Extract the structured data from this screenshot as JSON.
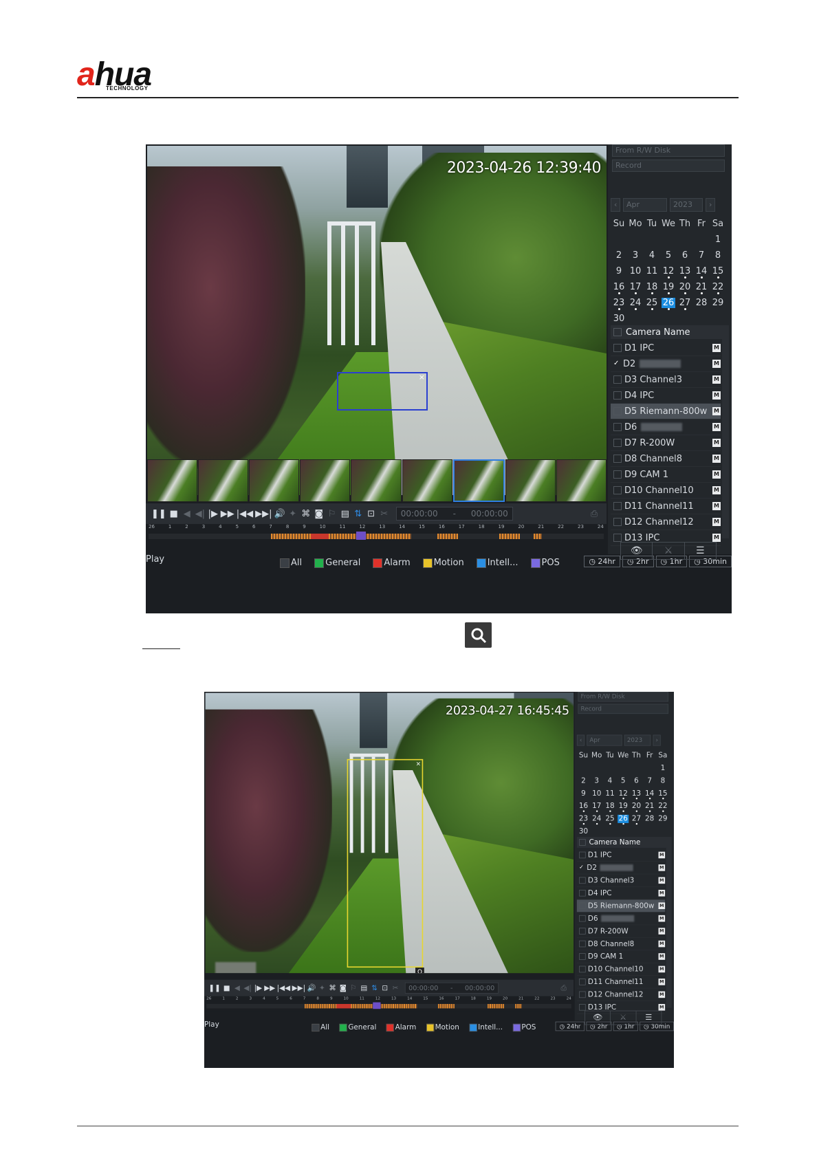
{
  "logo": {
    "brand_a": "a",
    "brand_rest": "hua",
    "subtitle": "TECHNOLOGY"
  },
  "player": {
    "timestamp_1": "2023-04-26 12:39:40",
    "timestamp_2": "2023-04-27 16:45:45",
    "toolbar_time_start": "00:00:00",
    "toolbar_time_end": "00:00:00",
    "timeline_hours": [
      "26",
      "1",
      "2",
      "3",
      "4",
      "5",
      "6",
      "7",
      "8",
      "9",
      "10",
      "11",
      "12",
      "13",
      "14",
      "15",
      "16",
      "17",
      "18",
      "19",
      "20",
      "21",
      "22",
      "23",
      "24"
    ],
    "play_label": "Play",
    "legend": [
      {
        "label": "All",
        "color": "#3a3f45"
      },
      {
        "label": "General",
        "color": "#22b14c"
      },
      {
        "label": "Alarm",
        "color": "#e0322b"
      },
      {
        "label": "Motion",
        "color": "#e8c32a"
      },
      {
        "label": "Intell...",
        "color": "#2b8fe3"
      },
      {
        "label": "POS",
        "color": "#7a6ae0"
      }
    ],
    "periods": [
      "24hr",
      "2hr",
      "1hr",
      "30min"
    ]
  },
  "panel": {
    "source_select": "From R/W Disk",
    "type_select": "Record",
    "month_select": "Apr",
    "year_select": "2023",
    "weekdays": [
      "Su",
      "Mo",
      "Tu",
      "We",
      "Th",
      "Fr",
      "Sa"
    ],
    "weeks": [
      [
        "",
        "",
        "",
        "",
        "",
        "",
        "1"
      ],
      [
        "2",
        "3",
        "4",
        "5",
        "6",
        "7",
        "8"
      ],
      [
        "9",
        "10",
        "11",
        "12",
        "13",
        "14",
        "15"
      ],
      [
        "16",
        "17",
        "18",
        "19",
        "20",
        "21",
        "22"
      ],
      [
        "23",
        "24",
        "25",
        "26",
        "27",
        "28",
        "29"
      ],
      [
        "30",
        "",
        "",
        "",
        "",
        "",
        ""
      ]
    ],
    "selected_day": "26",
    "camera_header": "Camera Name",
    "cameras": [
      {
        "label": "D1 IPC",
        "checked": false,
        "blurred": false
      },
      {
        "label": "D2",
        "checked": true,
        "blurred": true
      },
      {
        "label": "D3 Channel3",
        "checked": false,
        "blurred": false
      },
      {
        "label": "D4 IPC",
        "checked": false,
        "blurred": false
      },
      {
        "label": "D5 Riemann-800w",
        "checked": false,
        "blurred": false,
        "highlighted": true
      },
      {
        "label": "D6",
        "checked": false,
        "blurred": true
      },
      {
        "label": "D7 R-200W",
        "checked": false,
        "blurred": false
      },
      {
        "label": "D8 Channel8",
        "checked": false,
        "blurred": false
      },
      {
        "label": "D9 CAM 1",
        "checked": false,
        "blurred": false
      },
      {
        "label": "D10 Channel10",
        "checked": false,
        "blurred": false
      },
      {
        "label": "D11 Channel11",
        "checked": false,
        "blurred": false
      },
      {
        "label": "D12 Channel12",
        "checked": false,
        "blurred": false
      },
      {
        "label": "D13 IPC",
        "checked": false,
        "blurred": false
      }
    ],
    "m_badge": "M"
  }
}
